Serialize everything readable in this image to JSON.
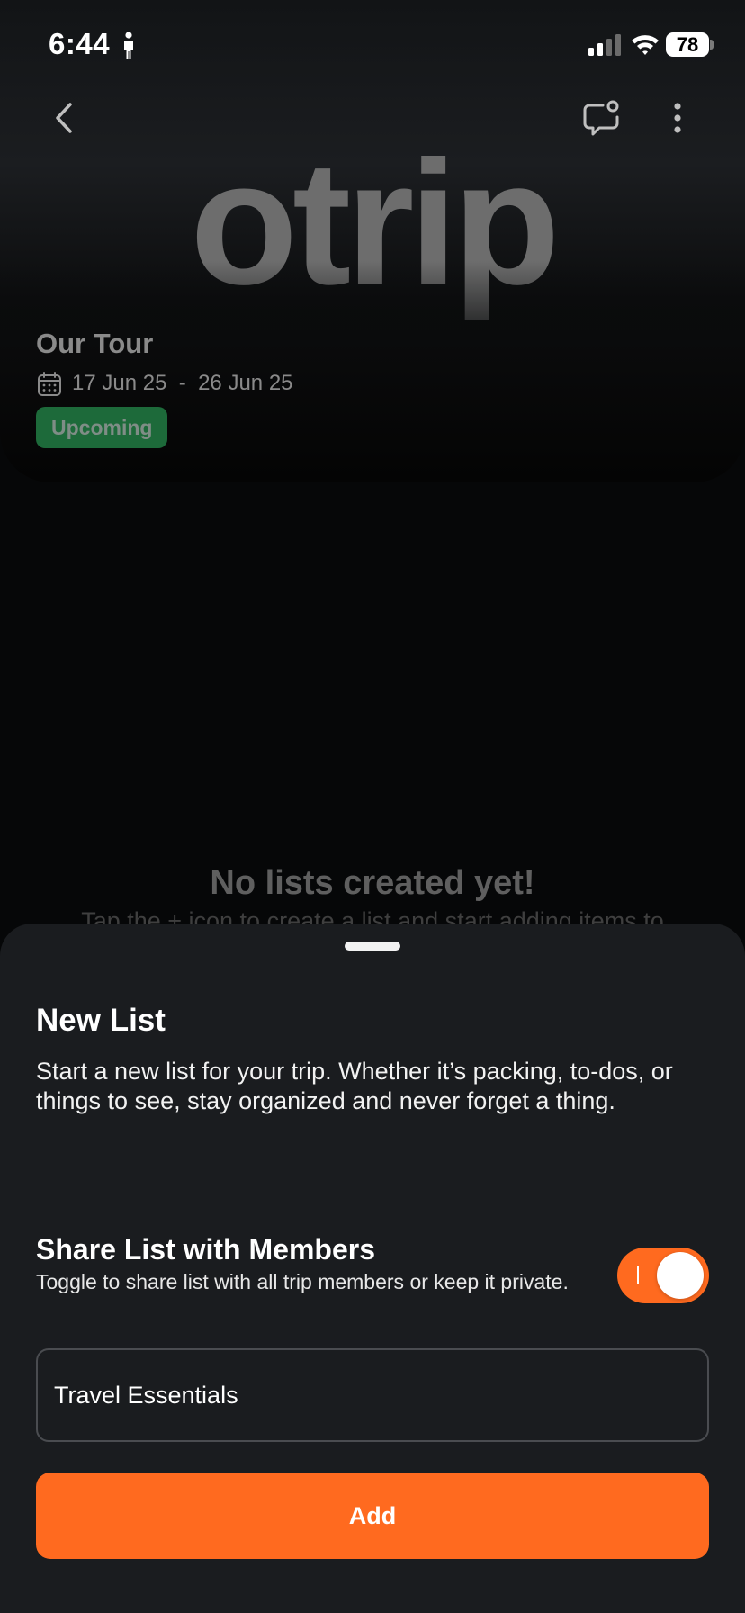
{
  "status_bar": {
    "time": "6:44",
    "battery": "78"
  },
  "header": {
    "logo_text": "otrip",
    "trip_title": "Our Tour",
    "trip_dates": "17 Jun 25  -  26 Jun 25",
    "status_badge": "Upcoming",
    "icons": {
      "back": "chevron-left-icon",
      "chat": "chat-notification-icon",
      "more": "more-vertical-icon",
      "calendar": "calendar-icon"
    }
  },
  "empty_state": {
    "title": "No lists created yet!",
    "subtitle": "Tap the + icon to create a list and start adding items to"
  },
  "sheet": {
    "title": "New List",
    "description": "Start a new list for your trip. Whether it’s packing, to-dos, or things to see, stay organized and never forget a thing.",
    "share_title": "Share List with Members",
    "share_description": "Toggle to share list with all trip members or keep it private.",
    "share_toggle_on": true,
    "list_name_value": "Travel Essentials",
    "add_label": "Add"
  },
  "colors": {
    "accent": "#ff6a1f",
    "badge_bg": "#1d6a3a",
    "sheet_bg": "#1a1c1f"
  }
}
